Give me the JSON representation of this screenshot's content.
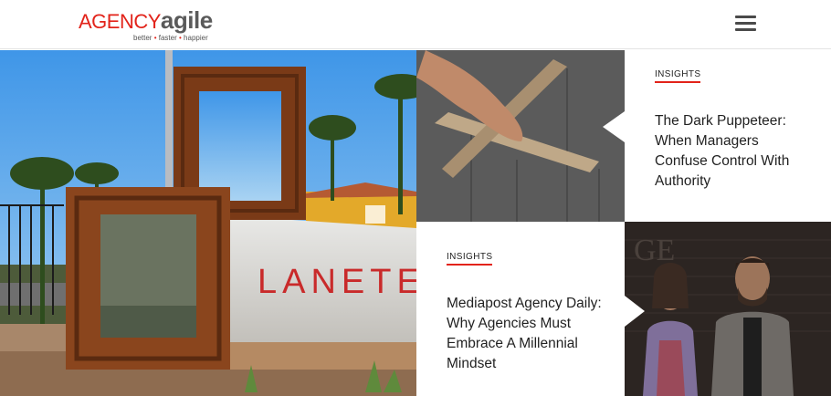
{
  "header": {
    "logo": {
      "word1": "AGENCY",
      "word2": "agile",
      "tagline": [
        "better",
        "faster",
        "happier"
      ],
      "tagline_sep": "•"
    },
    "menu_icon": "hamburger-menu-icon"
  },
  "hero": {
    "sign_text": "LANETER"
  },
  "posts": [
    {
      "category": "INSIGHTS",
      "title": "The Dark Puppeteer: When Managers Confuse Control With Authority"
    },
    {
      "category": "INSIGHTS",
      "title": "Mediapost Agency Daily: Why Agencies Must Embrace A Millennial Mindset"
    }
  ],
  "colors": {
    "accent": "#e2231a",
    "logo_grey": "#5a5a5a",
    "text": "#222222"
  }
}
